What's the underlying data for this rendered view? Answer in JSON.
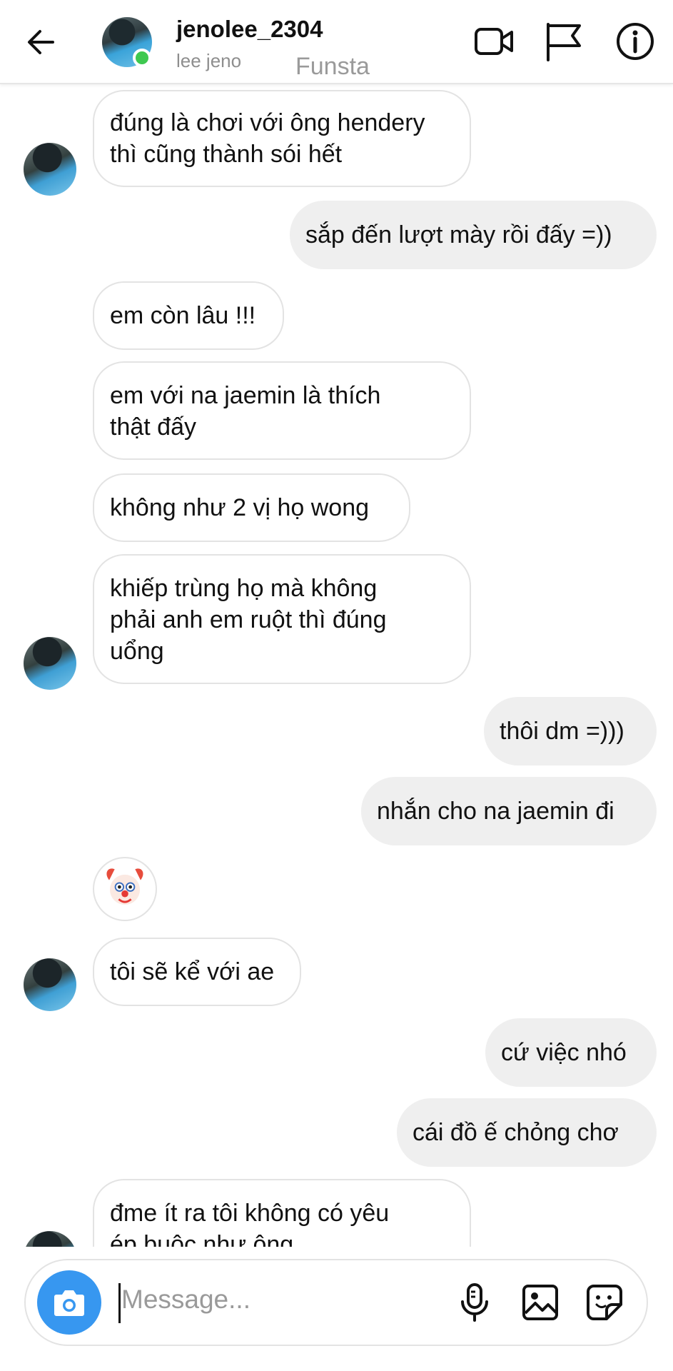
{
  "header": {
    "username": "jenolee_2304",
    "full_name": "lee jeno",
    "watermark": "Funsta",
    "icons": [
      "back-arrow-icon",
      "video-call-icon",
      "flag-icon",
      "info-icon"
    ]
  },
  "messages": [
    {
      "from": "them",
      "lines": [
        "đúng là chơi với ông hendery",
        "thì cũng thành sói hết"
      ]
    },
    {
      "from": "me",
      "lines": [
        "sắp đến lượt mày rồi đấy =))"
      ]
    },
    {
      "from": "them",
      "lines": [
        "em còn lâu !!!"
      ]
    },
    {
      "from": "them",
      "lines": [
        "em với na jaemin là thích",
        "thật đấy"
      ]
    },
    {
      "from": "them",
      "lines": [
        "không như 2 vị họ wong"
      ]
    },
    {
      "from": "them",
      "lines": [
        "khiếp trùng họ mà không",
        "phải anh em ruột thì đúng",
        "uổng"
      ]
    },
    {
      "from": "me",
      "lines": [
        "thôi dm =)))"
      ]
    },
    {
      "from": "me",
      "lines": [
        "nhắn cho na jaemin đi"
      ]
    },
    {
      "from": "them",
      "emoji": "clown-face"
    },
    {
      "from": "them",
      "lines": [
        "tôi sẽ kể với ae"
      ]
    },
    {
      "from": "me",
      "lines": [
        "cứ việc nhó"
      ]
    },
    {
      "from": "me",
      "lines": [
        "cái đồ ế chỏng chơ"
      ]
    },
    {
      "from": "them",
      "lines": [
        "đme ít ra tôi không có yêu",
        "ép buộc như ông"
      ]
    }
  ],
  "composer": {
    "placeholder": "Message...",
    "icons": [
      "camera-icon",
      "microphone-icon",
      "gallery-icon",
      "sticker-icon"
    ]
  },
  "colors": {
    "accent": "#3797f0",
    "online": "#3ec850",
    "outgoing_bubble": "#efefef",
    "incoming_border": "#e3e3e3"
  }
}
